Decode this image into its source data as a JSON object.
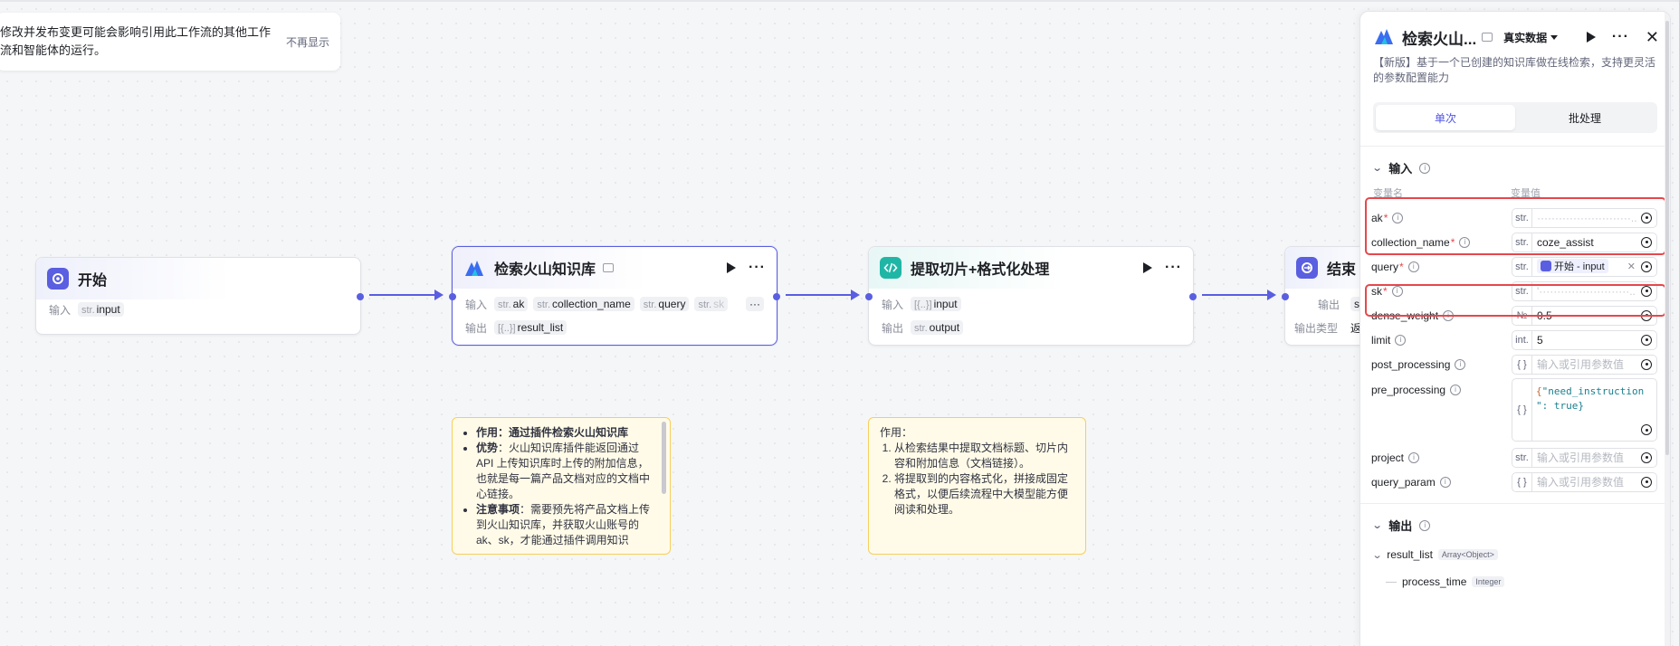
{
  "notice": {
    "text": "修改并发布变更可能会影响引用此工作流的其他工作流和智能体的运行。",
    "dismiss": "不再显示"
  },
  "nodes": {
    "start": {
      "title": "开始",
      "input_label": "输入",
      "input": {
        "type": "str.",
        "name": "input"
      }
    },
    "search": {
      "title": "检索火山知识库",
      "input_label": "输入",
      "output_label": "输出",
      "inputs": [
        {
          "type": "str.",
          "name": "ak"
        },
        {
          "type": "str.",
          "name": "collection_name"
        },
        {
          "type": "str.",
          "name": "query"
        },
        {
          "type": "str.",
          "name": "sk"
        }
      ],
      "more": "···",
      "output": {
        "type": "[{..}]",
        "name": "result_list"
      }
    },
    "code": {
      "title": "提取切片+格式化处理",
      "input_label": "输入",
      "output_label": "输出",
      "input": {
        "type": "[{..}]",
        "name": "input"
      },
      "output": {
        "type": "str.",
        "name": "output"
      }
    },
    "end": {
      "title": "结束",
      "output_label": "输出",
      "output_type_label": "输出类型",
      "output_type_value": "返",
      "output_tag": "st"
    }
  },
  "notes": {
    "search": {
      "items": [
        {
          "bold": "作用",
          "text": "：通过插件检索火山知识库"
        },
        {
          "bold": "优势",
          "text": "：火山知识库插件能返回通过 API 上传知识库时上传的附加信息，也就是每一篇产品文档对应的文档中心链接。"
        },
        {
          "bold": "注意事项",
          "text": "：需要预先将产品文档上传到火山知识库，并获取火山账号的 ak、sk，才能通过插件调用知识"
        }
      ]
    },
    "code": {
      "title": "作用：",
      "items": [
        "从检索结果中提取文档标题、切片内容和附加信息（文档链接）。",
        "将提取到的内容格式化，拼接成固定格式，以便后续流程中大模型能方便阅读和处理。"
      ]
    }
  },
  "panel": {
    "title": "检索火山...",
    "mode": "真实数据",
    "description": "【新版】基于一个已创建的知识库做在线检索，支持更灵活的参数配置能力",
    "tabs": [
      "单次",
      "批处理"
    ],
    "input_section": "输入",
    "col_name": "变量名",
    "col_value": "变量值",
    "params": [
      {
        "name": "ak",
        "required": true,
        "type": "str.",
        "value": "··························..",
        "blurred": true
      },
      {
        "name": "collection_name",
        "required": true,
        "type": "str.",
        "value": "coze_assist"
      },
      {
        "name": "query",
        "required": true,
        "type": "str.",
        "ref": "开始 - input"
      },
      {
        "name": "sk",
        "required": true,
        "type": "str.",
        "value": "'·························..",
        "blurred": true
      },
      {
        "name": "dense_weight",
        "required": false,
        "type": "№",
        "value": "0.5"
      },
      {
        "name": "limit",
        "required": false,
        "type": "int.",
        "value": "5"
      },
      {
        "name": "post_processing",
        "required": false,
        "type": "{ }",
        "placeholder": "输入或引用参数值"
      }
    ],
    "pre_processing": {
      "name": "pre_processing",
      "type": "{ }",
      "code_line1_key": "\"need_instruction",
      "code_line2": "\": true}"
    },
    "params2": [
      {
        "name": "project",
        "type": "str.",
        "placeholder": "输入或引用参数值"
      },
      {
        "name": "query_param",
        "type": "{ }",
        "placeholder": "输入或引用参数值"
      }
    ],
    "output_section": "输出",
    "outputs": [
      {
        "name": "result_list",
        "type": "Array<Object>"
      },
      {
        "name": "process_time",
        "type": "Integer"
      }
    ]
  },
  "colors": {
    "accent": "#5a5ee0",
    "highlight": "#e5484d",
    "note_border": "#f6cf5a"
  }
}
